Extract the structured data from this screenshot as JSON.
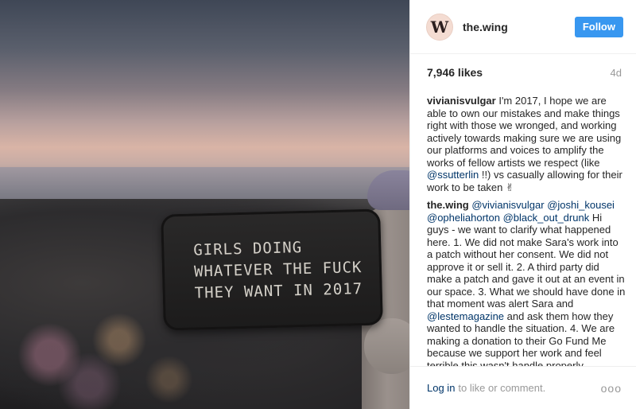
{
  "patch": {
    "lines": [
      "GIRLS DOING",
      "WHATEVER THE FUCK",
      "THEY WANT IN 2017"
    ]
  },
  "header": {
    "avatar_letter": "W",
    "username": "the.wing",
    "follow_label": "Follow"
  },
  "stats": {
    "likes": "7,946 likes",
    "time": "4d"
  },
  "comments": {
    "c1": {
      "author": "vivianisvulgar",
      "t1": " I'm 2017, I hope we are able to own our mistakes and make things right with those we wronged, and working actively towards making sure we are using our platforms and voices to amplify the works of fellow artists we respect (like ",
      "m1": "@ssutterlin",
      "t2": " !!) vs casually allowing for their work to be taken ✌"
    },
    "c2": {
      "author": "the.wing",
      "m1": "@vivianisvulgar",
      "m2": "@joshi_kousei",
      "m3": "@opheliahorton",
      "m4": "@black_out_drunk",
      "t1": " Hi guys - we want to clarify what happened here. 1. We did not make Sara's work into a patch without her consent. We did not approve it or sell it. 2. A third party did make a patch and gave it out at an event in our space. 3. What we should have done in that moment was alert Sara and ",
      "m5": "@lestemagazine",
      "t2": " and ask them how they wanted to handle the situation. 4. We are making a donation to their Go Fund Me because we support her work and feel terrible this wasn't handle properly."
    }
  },
  "footer": {
    "login_label": "Log in",
    "rest_text": "to like or comment.",
    "more_label": "ooo"
  },
  "colors": {
    "follow_button": "#3897f0",
    "mention": "#003569",
    "muted": "#999999"
  }
}
